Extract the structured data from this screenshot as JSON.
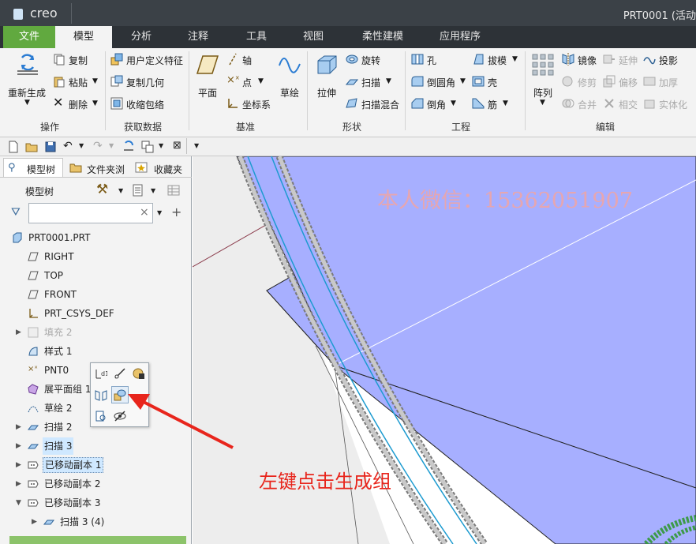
{
  "app": {
    "logo": "creo",
    "window_title": "PRT0001 (活动"
  },
  "menubar": [
    "文件",
    "模型",
    "分析",
    "注释",
    "工具",
    "视图",
    "柔性建模",
    "应用程序"
  ],
  "ribbon": {
    "operations": {
      "regen": "重新生成",
      "copy": "复制",
      "paste": "粘贴",
      "delete": "删除",
      "title": "操作"
    },
    "get_data": {
      "udf": "用户定义特征",
      "copy_geom": "复制几何",
      "shrinkwrap": "收缩包络",
      "title": "获取数据"
    },
    "datum": {
      "plane": "平面",
      "axis": "轴",
      "point": "点",
      "csys": "坐标系",
      "sketch": "草绘",
      "title": "基准"
    },
    "shapes": {
      "extrude": "拉伸",
      "revolve": "旋转",
      "sweep": "扫描",
      "swept_blend": "扫描混合",
      "title": "形状"
    },
    "engineering": {
      "hole": "孔",
      "draft": "拔模",
      "round": "倒圆角",
      "shell": "壳",
      "chamfer": "倒角",
      "rib": "筋",
      "title": "工程"
    },
    "editing": {
      "pattern": "阵列",
      "mirror": "镜像",
      "extend": "延伸",
      "project": "投影",
      "trim": "修剪",
      "offset": "偏移",
      "thicken": "加厚",
      "merge": "合并",
      "intersect": "相交",
      "solidify": "实体化",
      "title": "编辑"
    }
  },
  "left_tabs": [
    "模型树",
    "文件夹浏",
    "收藏夹"
  ],
  "tree_header": "模型树",
  "search": {
    "value": "",
    "clear": "×"
  },
  "tree_items": [
    {
      "label": "PRT0001.PRT"
    },
    {
      "label": "RIGHT"
    },
    {
      "label": "TOP"
    },
    {
      "label": "FRONT"
    },
    {
      "label": "PRT_CSYS_DEF"
    },
    {
      "label": "填充 2"
    },
    {
      "label": "样式 1"
    },
    {
      "label": "PNT0"
    },
    {
      "label": "展平面组 1"
    },
    {
      "label": "草绘 2"
    },
    {
      "label": "扫描 2"
    },
    {
      "label": "扫描 3"
    },
    {
      "label": "已移动副本 1"
    },
    {
      "label": "已移动副本 2"
    },
    {
      "label": "已移动副本 3"
    },
    {
      "label": "扫描 3 (4)"
    }
  ],
  "watermark": "本人微信：15362051907",
  "annotation": "左键点击生成组",
  "colors": {
    "accent_green": "#61a93f",
    "surface_blue": "#a7afff",
    "annotation_red": "#e8251c"
  }
}
